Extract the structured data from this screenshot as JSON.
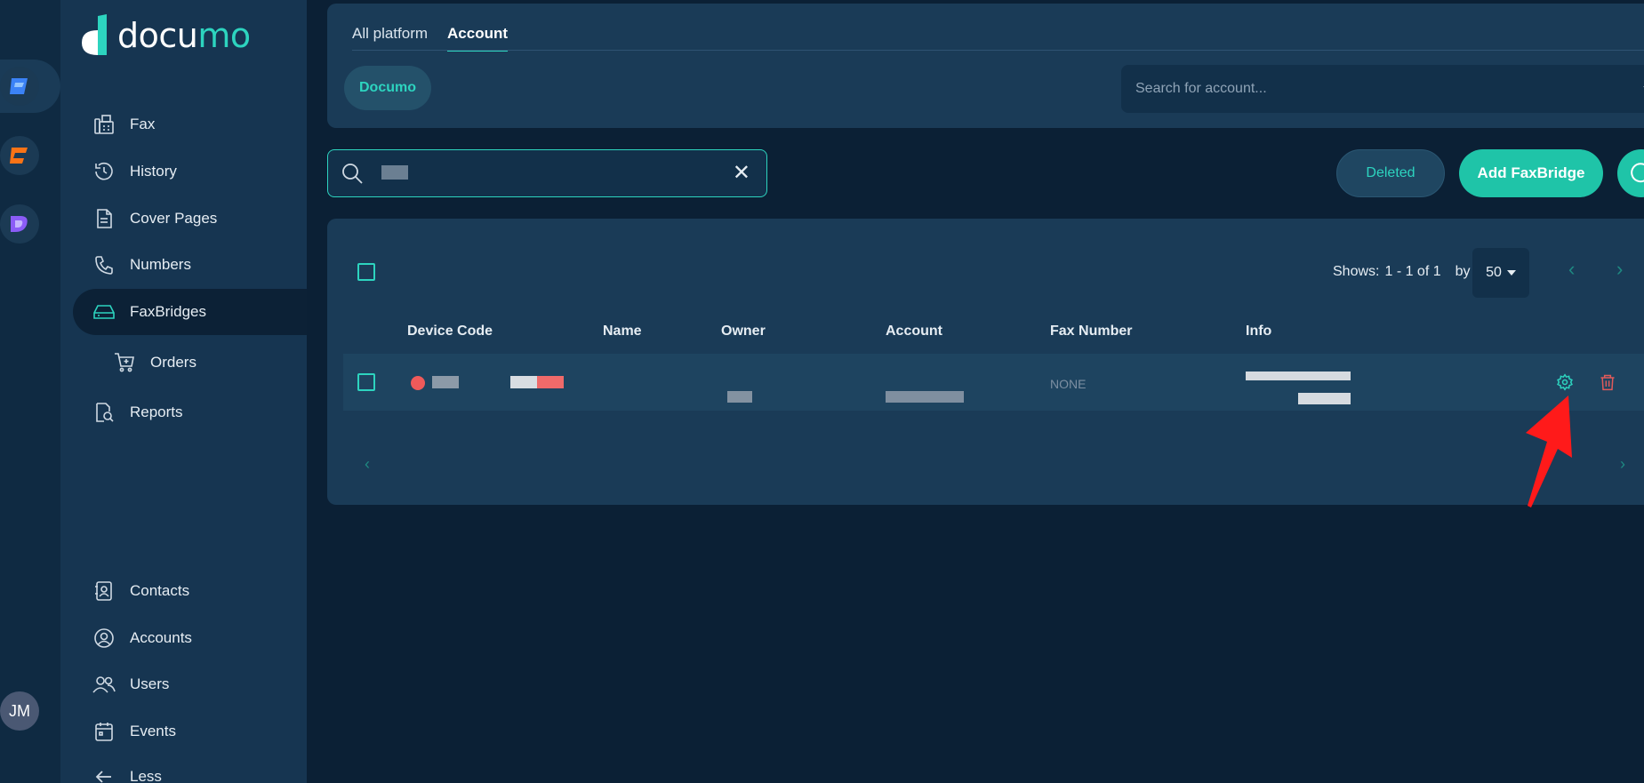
{
  "app": {
    "brand": "documo",
    "avatar_initials": "JM"
  },
  "sidebar": {
    "items": [
      {
        "label": "Fax",
        "icon": "fax-icon"
      },
      {
        "label": "History",
        "icon": "history-icon"
      },
      {
        "label": "Cover Pages",
        "icon": "cover-pages-icon"
      },
      {
        "label": "Numbers",
        "icon": "phone-icon"
      },
      {
        "label": "FaxBridges",
        "icon": "faxbridge-icon",
        "active": true
      },
      {
        "label": "Orders",
        "icon": "cart-icon"
      },
      {
        "label": "Reports",
        "icon": "reports-icon"
      },
      {
        "label": "Contacts",
        "icon": "contacts-icon"
      },
      {
        "label": "Accounts",
        "icon": "accounts-icon"
      },
      {
        "label": "Users",
        "icon": "users-icon"
      },
      {
        "label": "Events",
        "icon": "calendar-icon"
      },
      {
        "label": "Less",
        "icon": "arrow-left-icon"
      }
    ]
  },
  "header": {
    "tabs": [
      {
        "label": "All platform"
      },
      {
        "label": "Account",
        "active": true
      }
    ],
    "chip_label": "Documo",
    "account_search_placeholder": "Search for account..."
  },
  "toolbar": {
    "deleted_label": "Deleted",
    "add_label": "Add FaxBridge"
  },
  "table": {
    "shows_label": "Shows:",
    "range": "1 - 1 of 1",
    "by_label": "by",
    "per_page": "50",
    "columns": [
      "Device Code",
      "Name",
      "Owner",
      "Account",
      "Fax Number",
      "Info"
    ],
    "rows": [
      {
        "fax_number": "NONE",
        "status_color": "#ef5a5a"
      }
    ]
  },
  "colors": {
    "accent": "#2dd4bf",
    "background": "#0b2035",
    "panel": "#1a3b57",
    "sidebar": "#163551",
    "danger": "#e05a5a",
    "annotation_arrow": "#ff1a1a"
  }
}
